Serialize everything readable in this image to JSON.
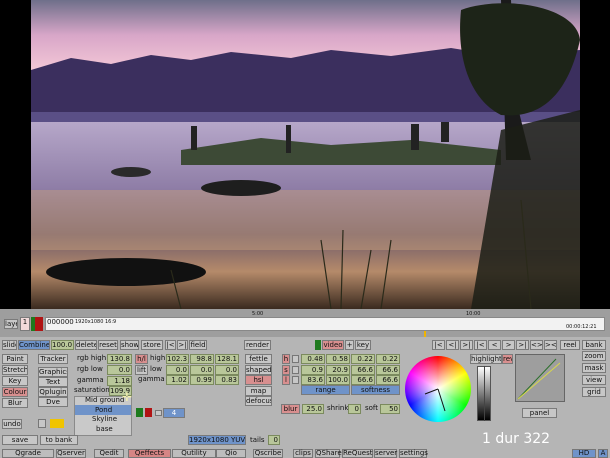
{
  "timeline": {
    "layer_label": "layer",
    "layer_number": "1",
    "timecode": "000000",
    "clip_info": "1920x1080 16:9",
    "ruler_marks": [
      "5:00",
      "10:00"
    ],
    "end_time": "00:00:12:21"
  },
  "toolbar": {
    "slide": "slide",
    "combine": "Combine",
    "combine_value": "100.0",
    "delete": "delete",
    "reset": "reset",
    "show": "show",
    "store": "store",
    "prev": "|<",
    "next": ">|",
    "field": "field",
    "render": "render",
    "video": "video",
    "plus": "+",
    "key": "key",
    "reel": "reel",
    "bank": "bank"
  },
  "transport": [
    "|<",
    "<|",
    ">|",
    "|<",
    "<",
    ">",
    ">|",
    "<>",
    "><"
  ],
  "left_tools": [
    "Paint",
    "Stretch",
    "Key",
    "Colour",
    "Blur"
  ],
  "tools2": [
    "Tracker",
    "Graphics",
    "Text",
    "Qplugin",
    "Dve"
  ],
  "grading": {
    "rows": [
      {
        "label": "rgb high",
        "value": "130.8"
      },
      {
        "label": "rgb low",
        "value": "0.0"
      },
      {
        "label": "gamma",
        "value": "1.18"
      },
      {
        "label": "saturation",
        "value": "109.9"
      }
    ],
    "hl_label": "h/l",
    "lift_label": "lift",
    "mid_rows": [
      {
        "label": "high",
        "values": [
          "102.3",
          "98.8",
          "128.1"
        ]
      },
      {
        "label": "low",
        "values": [
          "0.0",
          "0.0",
          "0.0"
        ]
      },
      {
        "label": "gamma",
        "values": [
          "1.02",
          "0.99",
          "0.83"
        ]
      }
    ]
  },
  "dropdown": {
    "options": [
      "Mid ground",
      "Pond",
      "Skyline",
      "base"
    ],
    "selected": "Pond"
  },
  "layer_index": "4",
  "fettle": {
    "fettle": "fettle",
    "shaped": "shaped",
    "hsl": "hsl",
    "map": "map",
    "defocus": "defocus"
  },
  "hsl_letters": [
    "h",
    "s",
    "l"
  ],
  "hsl_values": [
    [
      "0.48",
      "0.58",
      "0.22",
      "0.22"
    ],
    [
      "0.9",
      "20.9",
      "66.6",
      "66.6"
    ],
    [
      "83.6",
      "100.0",
      "66.6",
      "66.6"
    ]
  ],
  "range_label": "range",
  "softness_label": "softness",
  "blur": {
    "label": "blur",
    "value": "25.0",
    "shrink_label": "shrink",
    "shrink_value": "0",
    "soft_label": "soft",
    "soft_value": "50"
  },
  "highlight": "highlight",
  "rev": "rev",
  "panel_label": "panel",
  "right_buttons": [
    "zoom",
    "mask",
    "view",
    "grid"
  ],
  "duration": "1 dur 322",
  "undo": "undo",
  "save": "save",
  "to_bank": "to bank",
  "format": {
    "label": "1920x1080 YUV",
    "tails_label": "tails",
    "tails_value": "0"
  },
  "bottom_tabs": [
    "Qgrade",
    "Qserver",
    "Qedit",
    "Qeffects",
    "Qutility",
    "Qio",
    "Qscribe"
  ],
  "bottom_tabs2": [
    "clips",
    "QShare",
    "ReQuest",
    "server",
    "settings"
  ],
  "hd": "HD",
  "a": "A",
  "colors": {
    "panel": "#b5b5b5",
    "button": "#c7c7c7",
    "numeric": "#b9c79a",
    "red_button": "#d88f8f",
    "blue": "#6f93c9",
    "active_tab": "#d68585"
  }
}
